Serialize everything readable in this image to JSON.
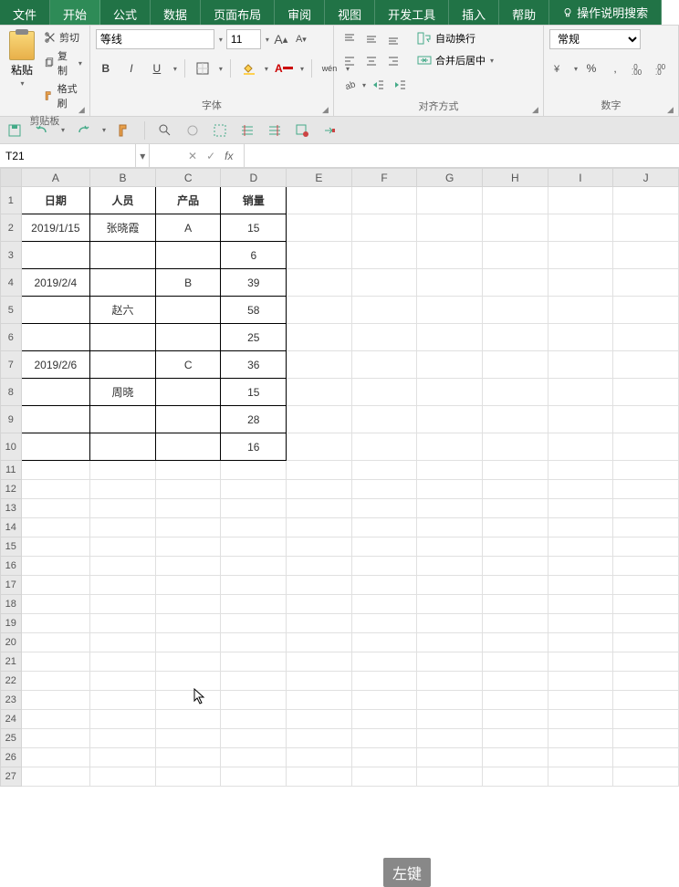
{
  "menu": {
    "file": "文件",
    "home": "开始",
    "formula": "公式",
    "data": "数据",
    "layout": "页面布局",
    "review": "审阅",
    "view": "视图",
    "dev": "开发工具",
    "insert": "插入",
    "help": "帮助",
    "tell": "操作说明搜索"
  },
  "ribbon": {
    "clipboard": {
      "paste": "粘贴",
      "cut": "剪切",
      "copy": "复制",
      "brush": "格式刷",
      "label": "剪贴板"
    },
    "font": {
      "name": "等线",
      "size": "11",
      "bold": "B",
      "italic": "I",
      "underline": "U",
      "label": "字体",
      "aplus": "A",
      "aminus": "A",
      "wen": "wén"
    },
    "align": {
      "wrap": "自动换行",
      "merge": "合并后居中",
      "label": "对齐方式"
    },
    "number": {
      "format": "常规",
      "label": "数字"
    }
  },
  "namebox": "T21",
  "formula": "",
  "columns": [
    "A",
    "B",
    "C",
    "D",
    "E",
    "F",
    "G",
    "H",
    "I",
    "J"
  ],
  "row_headers": [
    "1",
    "2",
    "3",
    "4",
    "5",
    "6",
    "7",
    "8",
    "9",
    "10",
    "11",
    "12",
    "13",
    "14",
    "15",
    "16",
    "17",
    "18",
    "19",
    "20",
    "21",
    "22",
    "23",
    "24",
    "25",
    "26",
    "27"
  ],
  "table": {
    "headers": {
      "date": "日期",
      "person": "人员",
      "product": "产品",
      "sales": "销量"
    },
    "rows": [
      {
        "date": "2019/1/15",
        "person": "张晓霞",
        "product": "A",
        "sales": "15"
      },
      {
        "date": "",
        "person": "",
        "product": "",
        "sales": "6"
      },
      {
        "date": "2019/2/4",
        "person": "",
        "product": "B",
        "sales": "39"
      },
      {
        "date": "",
        "person": "赵六",
        "product": "",
        "sales": "58"
      },
      {
        "date": "",
        "person": "",
        "product": "",
        "sales": "25"
      },
      {
        "date": "2019/2/6",
        "person": "",
        "product": "C",
        "sales": "36"
      },
      {
        "date": "",
        "person": "周晓",
        "product": "",
        "sales": "15"
      },
      {
        "date": "",
        "person": "",
        "product": "",
        "sales": "28"
      },
      {
        "date": "",
        "person": "",
        "product": "",
        "sales": "16"
      }
    ]
  },
  "tooltip": "左键"
}
